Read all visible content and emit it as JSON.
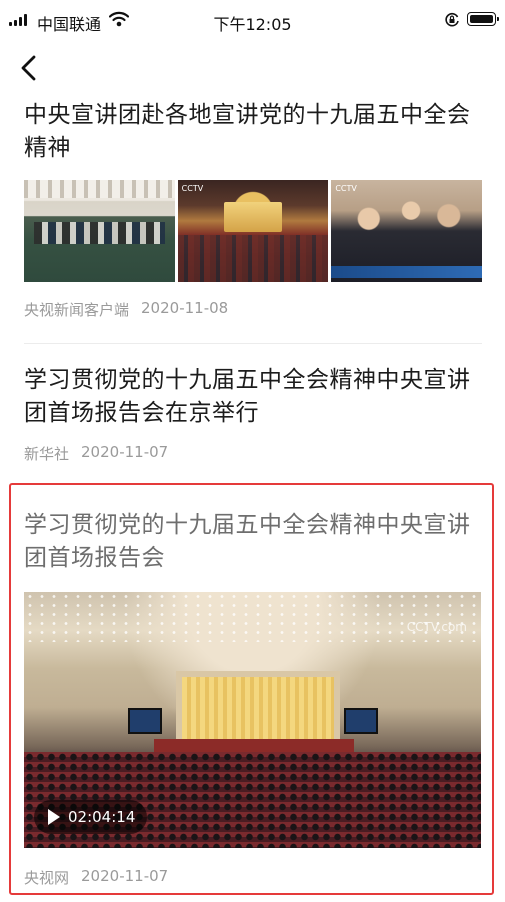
{
  "status_bar": {
    "carrier": "中国联通",
    "time": "下午12:05"
  },
  "articles": [
    {
      "title": "中央宣讲团赴各地宣讲党的十九届五中全会精神",
      "source": "央视新闻客户端",
      "date": "2020-11-08",
      "thumbnail_logo": "CCTV"
    },
    {
      "title": "学习贯彻党的十九届五中全会精神中央宣讲团首场报告会在京举行",
      "source": "新华社",
      "date": "2020-11-07"
    },
    {
      "title": "学习贯彻党的十九届五中全会精神中央宣讲团首场报告会",
      "source": "央视网",
      "date": "2020-11-07",
      "video_duration": "02:04:14",
      "video_logo": "CCTV.com"
    }
  ],
  "colors": {
    "highlight_border": "#e53a3a",
    "meta_text": "#9a9a9a"
  },
  "icons": {
    "back": "chevron-left-icon",
    "wifi": "wifi-icon",
    "orientation_lock": "orientation-lock-icon",
    "battery": "battery-icon",
    "play": "play-icon"
  }
}
